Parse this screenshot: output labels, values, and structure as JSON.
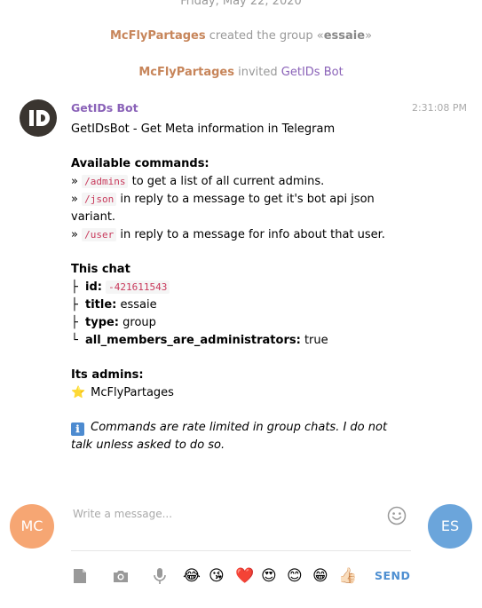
{
  "header": {
    "date": "Friday, May 22, 2020"
  },
  "service_messages": [
    {
      "user": "McFlyPartages",
      "text": " created the group «",
      "group": "essaie",
      "end": "»"
    },
    {
      "user": "McFlyPartages",
      "text": " invited ",
      "target": "GetIDs Bot"
    }
  ],
  "message": {
    "author": "GetIDs Bot",
    "time": "2:31:08 PM",
    "intro": "GetIDsBot - Get Meta information in Telegram",
    "commands_title": "Available commands:",
    "commands": [
      {
        "bullet": "»",
        "cmd": "/admins",
        "desc": "to get a list of all current admins."
      },
      {
        "bullet": "»",
        "cmd": "/json",
        "desc": "in reply to a message to get it's bot api json variant."
      },
      {
        "bullet": "»",
        "cmd": "/user",
        "desc": "in reply to a message for info about that user."
      }
    ],
    "chat_title": "This chat",
    "chat_fields": [
      {
        "branch": "├",
        "key": "id:",
        "value": "-421611543",
        "code": true
      },
      {
        "branch": "├",
        "key": "title:",
        "value": "essaie",
        "code": false
      },
      {
        "branch": "├",
        "key": "type:",
        "value": "group",
        "code": false
      },
      {
        "branch": "└",
        "key": "all_members_are_administrators:",
        "value": "true",
        "code": false
      }
    ],
    "admins_title": "Its admins:",
    "admins": [
      {
        "emoji": "⭐",
        "name": "McFlyPartages"
      }
    ],
    "note_icon": "ℹ",
    "note": "Commands are rate limited in group chats. I do not talk unless asked to do so."
  },
  "composer": {
    "my_initials": "MC",
    "peer_initials": "ES",
    "placeholder": "Write a message...",
    "send_label": "SEND",
    "quick_emojis": [
      "😂",
      "😘",
      "❤️",
      "😍",
      "😊",
      "😁",
      "👍🏻"
    ]
  },
  "colors": {
    "username": "#c7855a",
    "bot_name": "#8a62b8",
    "code": "#c8395b",
    "send": "#4e8fd1",
    "my_avatar": "#f6a673",
    "peer_avatar": "#6ba5db"
  }
}
